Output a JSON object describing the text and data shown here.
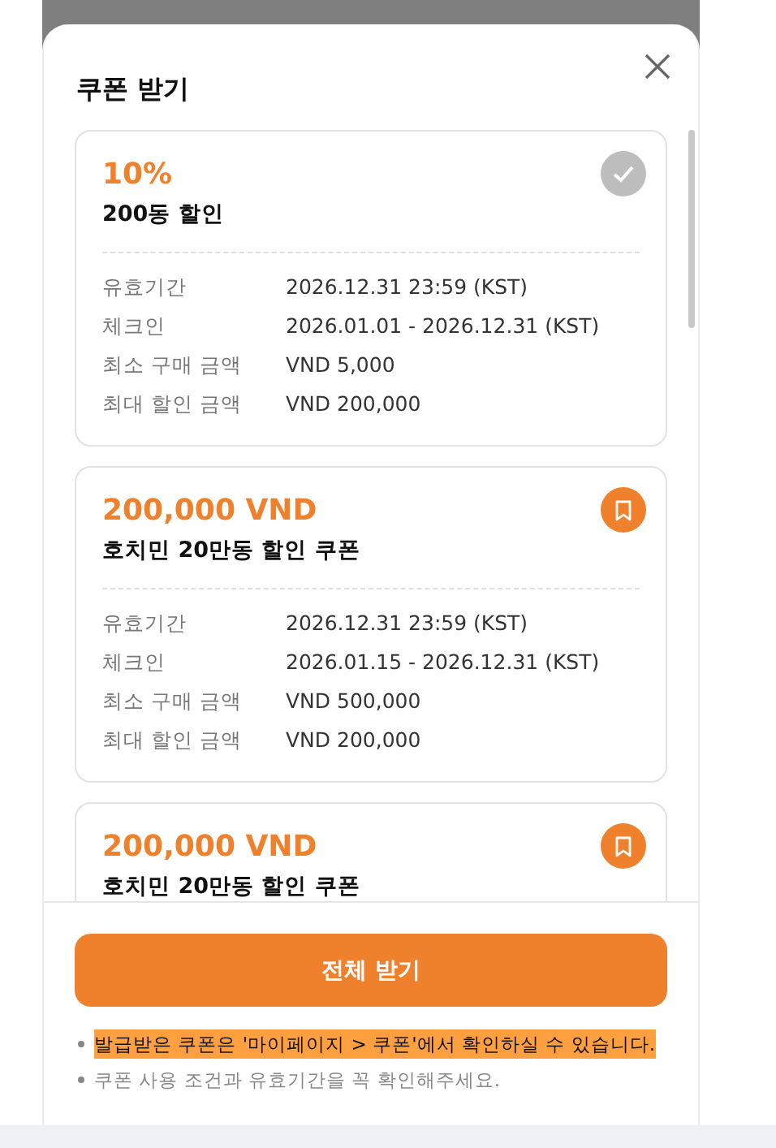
{
  "dialog": {
    "title": "쿠폰 받기"
  },
  "coupons": [
    {
      "amount": "10%",
      "name": "200동 할인",
      "claimed": true,
      "details": [
        {
          "label": "유효기간",
          "value": "2026.12.31 23:59 (KST)"
        },
        {
          "label": "체크인",
          "value": "2026.01.01 - 2026.12.31 (KST)"
        },
        {
          "label": "최소 구매 금액",
          "value": "VND 5,000"
        },
        {
          "label": "최대 할인 금액",
          "value": "VND 200,000"
        }
      ]
    },
    {
      "amount": "200,000 VND",
      "name": "호치민 20만동 할인 쿠폰",
      "claimed": false,
      "details": [
        {
          "label": "유효기간",
          "value": "2026.12.31 23:59 (KST)"
        },
        {
          "label": "체크인",
          "value": "2026.01.15 - 2026.12.31 (KST)"
        },
        {
          "label": "최소 구매 금액",
          "value": "VND 500,000"
        },
        {
          "label": "최대 할인 금액",
          "value": "VND 200,000"
        }
      ]
    },
    {
      "amount": "200,000 VND",
      "name": "호치민 20만동 할인 쿠폰",
      "claimed": false
    }
  ],
  "claim_all_button": "전체 받기",
  "notes": [
    {
      "text": "발급받은 쿠폰은 '마이페이지 > 쿠폰'에서 확인하실 수 있습니다.",
      "highlighted": true
    },
    {
      "text": "쿠폰 사용 조건과 유효기간을 꼭 확인해주세요.",
      "highlighted": false
    }
  ]
}
